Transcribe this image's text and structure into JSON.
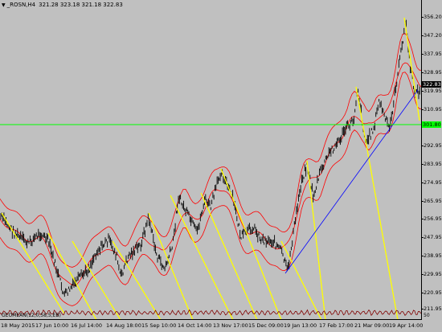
{
  "header": {
    "symbol": "_ROSN,H4",
    "ohlc": "321.28 323.18 321.18 322.83",
    "menu_icon": "triangle-down-icon"
  },
  "y_axis": {
    "ticks": [
      "356.20",
      "347.20",
      "337.95",
      "328.95",
      "319.95",
      "310.95",
      "292.95",
      "283.95",
      "274.95",
      "265.95",
      "256.95",
      "247.95",
      "238.95",
      "229.95",
      "220.95",
      "211.95"
    ],
    "last_price": "322.83",
    "hline_price": "301.80"
  },
  "x_axis": {
    "ticks": [
      "18 May 2015",
      "17 Jun 10:00",
      "16 Jul 14:00",
      "14 Aug 18:00",
      "15 Sep 10:00",
      "14 Oct 14:00",
      "13 Nov 17:00",
      "15 Dec 09:00",
      "19 Jan 13:00",
      "17 Feb 17:00",
      "21 Mar 09:00",
      "19 Apr 14:00"
    ]
  },
  "oscillator": {
    "label": "GEOMEAN(12,0,58,5,EB)",
    "right_value": "50"
  },
  "colors": {
    "background": "#c0c0c0",
    "bars": "#000000",
    "bands": "#ff0000",
    "yellow_lines": "#ffff00",
    "trendline": "#0000ff",
    "hline": "#00ff00",
    "oscillator": "#800000"
  }
}
